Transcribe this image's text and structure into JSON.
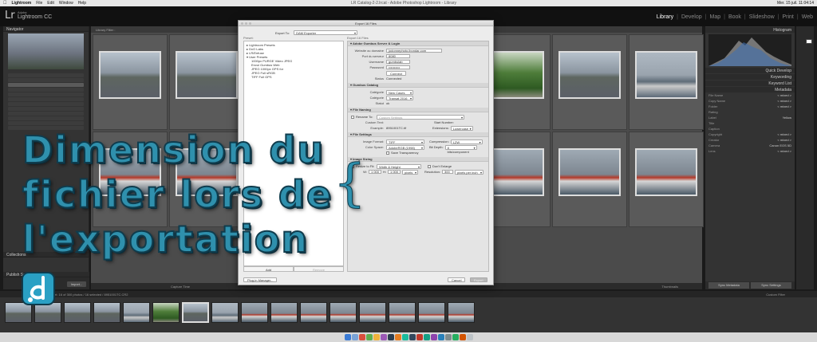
{
  "menubar": {
    "app": "Lightroom",
    "items": [
      "File",
      "Edit",
      "Window",
      "Help"
    ],
    "doc_title": "LR Catalog-2-2.lrcat - Adobe Photoshop Lightroom - Library",
    "datetime": "Mer. 15 juil. 11:04:14"
  },
  "lr": {
    "logo": "Lr",
    "brand_top": "Adobe",
    "brand_name": "Lightroom CC",
    "modules": [
      "Library",
      "Develop",
      "Map",
      "Book",
      "Slideshow",
      "Print",
      "Web"
    ],
    "active_module": "Library"
  },
  "left": {
    "navigator": "Navigator",
    "collections": "Collections",
    "publish": "Publish Services",
    "import": "Import..."
  },
  "center": {
    "filter": "Library Filter :",
    "sort_label": "Capture Time",
    "thumb_label": "Thumbnails"
  },
  "right": {
    "histogram": "Histogram",
    "quick_develop": "Quick Develop",
    "keywording": "Keywording",
    "keyword_list": "Keyword List",
    "metadata": "Metadata",
    "sync_metadata": "Sync Metadata",
    "sync_settings": "Sync Settings",
    "meta_rows": [
      {
        "k": "File Name",
        "v": "< mixed >"
      },
      {
        "k": "Copy Name",
        "v": "< mixed >"
      },
      {
        "k": "Folder",
        "v": "< mixed >"
      },
      {
        "k": "Rating",
        "v": ""
      },
      {
        "k": "Label",
        "v": "Yellow"
      },
      {
        "k": "Title",
        "v": ""
      },
      {
        "k": "Caption",
        "v": ""
      },
      {
        "k": "Copyright",
        "v": "< mixed >"
      },
      {
        "k": "Creator",
        "v": "< mixed >"
      },
      {
        "k": "Camera",
        "v": "Canon EOS 5D"
      },
      {
        "k": "Lens",
        "v": "< mixed >"
      }
    ]
  },
  "filmstrip": {
    "crumb": "Import: 16 of 300 photos / 16 selected / 8951001TC.CR2",
    "filter": "Custom Filter"
  },
  "dialog": {
    "title": "Export 16 Files",
    "export_to_label": "Export To:",
    "export_to_value": "DAM Exporter",
    "preset_heading": "Preset:",
    "files_heading": "Export 16 Files",
    "presets": [
      {
        "t": "▸ Lightroom Presets",
        "lvl": 0
      },
      {
        "t": "▸ DxO Labs",
        "lvl": 0
      },
      {
        "t": "▸ LR/Enfuse",
        "lvl": 0
      },
      {
        "t": "▾ User Presets",
        "lvl": 0
      },
      {
        "t": "1000px PURGE Video JPEG",
        "lvl": 1
      },
      {
        "t": "Envoi Gumbus Web",
        "lvl": 1
      },
      {
        "t": "JPEG 1000px GPS for",
        "lvl": 1
      },
      {
        "t": "JPEG Full sRGB",
        "lvl": 1
      },
      {
        "t": "TIFF Full GPS",
        "lvl": 1
      }
    ],
    "add": "Add",
    "remove": "Remove",
    "s_server": "Adobe Gumbus Server & Login",
    "website_label": "Website ou domaine",
    "website_value": "jodonnephoto.ibondar.com",
    "port_label": "Port du serveur",
    "port_value": "8080",
    "user_label": "Username",
    "user_value": "gumbulab",
    "pass_label": "Password",
    "pass_value": "••••••••••",
    "connect": "Connect",
    "status_label": "Status",
    "status_value": "Connected",
    "s_catalog": "Gumbus Catalog",
    "category_label": "Catégorie",
    "category_value": "New Cases",
    "cat2_label": "Catégorie",
    "cat2_value": "Transat 2016",
    "statut_label": "Statut",
    "statut_value": "ok",
    "s_naming": "File Naming",
    "rename_label": "Rename To:",
    "rename_value": "Custom Settings",
    "custom_text_label": "Custom Text:",
    "start_number_label": "Start Number:",
    "example_label": "Example:",
    "example_value": "8951001TC.tif",
    "ext_label": "Extensions:",
    "ext_value": "Lowercase",
    "s_settings": "File Settings",
    "format_label": "Image Format:",
    "format_value": "TIFF",
    "compression_label": "Compression:",
    "compression_value": "LZW",
    "colorspace_label": "Color Space:",
    "colorspace_value": "AdobeRGB (1998)",
    "bitdepth_label": "Bit Depth:",
    "bitdepth_value": "8 bits/component",
    "transparency": "Save Transparency",
    "s_sizing": "Image Sizing",
    "resize_label": "Resize to Fit:",
    "resize_value": "Width & Height",
    "dont_enlarge": "Don't Enlarge",
    "w_label": "W:",
    "w_value": "1 000",
    "h_label": "H:",
    "h_value": "1 000",
    "unit_value": "pixels",
    "res_label": "Resolution:",
    "res_value": "300",
    "res_unit": "pixels per inch",
    "plugin": "Plug-in Manager...",
    "cancel": "Cancel",
    "export": "Export"
  },
  "overlay": {
    "line1": "Dimension du",
    "line2": "fichier lors de",
    "line3": "l'exportation",
    "brace": "{"
  },
  "colors": {
    "overlay": "#2f90ad",
    "lr_dark": "#111111"
  }
}
